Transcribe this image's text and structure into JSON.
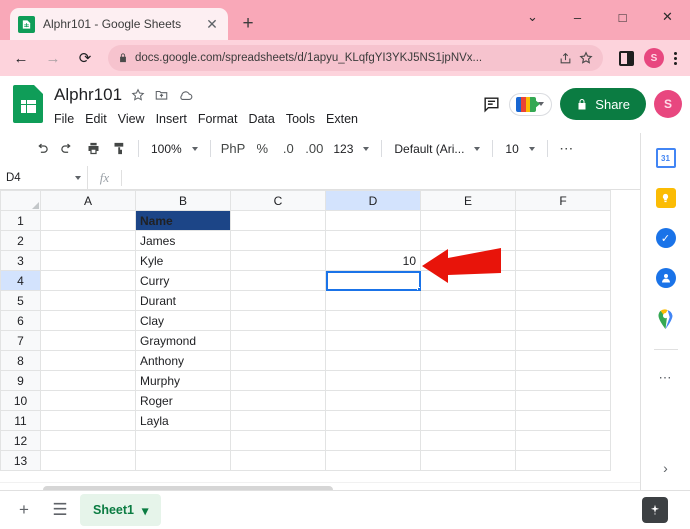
{
  "browser": {
    "tab": {
      "title": "Alphr101 - Google Sheets",
      "favicon": "sheets-favicon",
      "close": "✕"
    },
    "new_tab": "+",
    "window_controls": {
      "tab_search": "⌄",
      "minimize": "–",
      "maximize": "□",
      "close": "✕"
    },
    "nav": {
      "back": "←",
      "forward": "→",
      "reload": "⟳"
    },
    "omnibox": {
      "url": "docs.google.com/spreadsheets/d/1apyu_KLqfgYI3YKJ5NS1jpNVx...",
      "lock_icon": "lock-icon"
    },
    "toolbar_right": {
      "share_icon": "share-icon",
      "bookmark_icon": "star-icon",
      "side_panel_icon": "side-panel-icon",
      "profile_initial": "S",
      "menu_icon": "kebab-menu-icon"
    }
  },
  "sheets": {
    "doc_title": "Alphr101",
    "title_icons": [
      "star-icon",
      "move-to-folder-icon",
      "cloud-saved-icon"
    ],
    "menu": [
      "File",
      "Edit",
      "View",
      "Insert",
      "Format",
      "Data",
      "Tools",
      "Exten"
    ],
    "header_right": {
      "comment_icon": "comment-icon",
      "meet_icon": "google-meet-icon",
      "share_label": "Share",
      "avatar_initial": "S"
    },
    "toolbar": {
      "undo": "undo-icon",
      "redo": "redo-icon",
      "print": "print-icon",
      "paint": "paint-format-icon",
      "zoom": "100%",
      "currency": "PhP",
      "percent": "%",
      "decrease_decimal": ".0",
      "increase_decimal": ".00",
      "more_formats": "123",
      "font": "Default (Ari...",
      "font_size": "10",
      "more": "⋯",
      "collapse": "∧"
    },
    "formula_bar": {
      "name_box": "D4",
      "fx_label": "fx",
      "formula_value": ""
    },
    "grid": {
      "columns": [
        "A",
        "B",
        "C",
        "D",
        "E",
        "F"
      ],
      "selected_column": "D",
      "selected_row": 4,
      "selected_cell": "D4",
      "rows": [
        {
          "n": "1",
          "cells": {
            "B": "Name"
          }
        },
        {
          "n": "2",
          "cells": {
            "B": "James"
          }
        },
        {
          "n": "3",
          "cells": {
            "B": "Kyle",
            "D": "10"
          }
        },
        {
          "n": "4",
          "cells": {
            "B": "Curry"
          }
        },
        {
          "n": "5",
          "cells": {
            "B": "Durant"
          }
        },
        {
          "n": "6",
          "cells": {
            "B": "Clay"
          }
        },
        {
          "n": "7",
          "cells": {
            "B": "Graymond"
          }
        },
        {
          "n": "8",
          "cells": {
            "B": "Anthony"
          }
        },
        {
          "n": "9",
          "cells": {
            "B": "Murphy"
          }
        },
        {
          "n": "10",
          "cells": {
            "B": "Roger"
          }
        },
        {
          "n": "11",
          "cells": {
            "B": "Layla"
          }
        },
        {
          "n": "12",
          "cells": {}
        },
        {
          "n": "13",
          "cells": {}
        }
      ],
      "header_cell_bg": "#1c4587",
      "header_cell_fg": "#ffffff"
    },
    "side_panel": {
      "items": [
        "google-calendar-icon",
        "google-keep-icon",
        "google-tasks-icon",
        "google-contacts-icon",
        "google-maps-icon"
      ],
      "calendar_day": "31",
      "more": "⋯",
      "expand": "›"
    },
    "bottom_bar": {
      "add_sheet": "+",
      "all_sheets": "☰",
      "sheet_name": "Sheet1",
      "sheet_menu_caret": "▾",
      "explore_icon": "explore-icon"
    }
  },
  "annotation": {
    "arrow": "red-left-arrow",
    "color": "#e8140a",
    "points_at": "D3"
  }
}
